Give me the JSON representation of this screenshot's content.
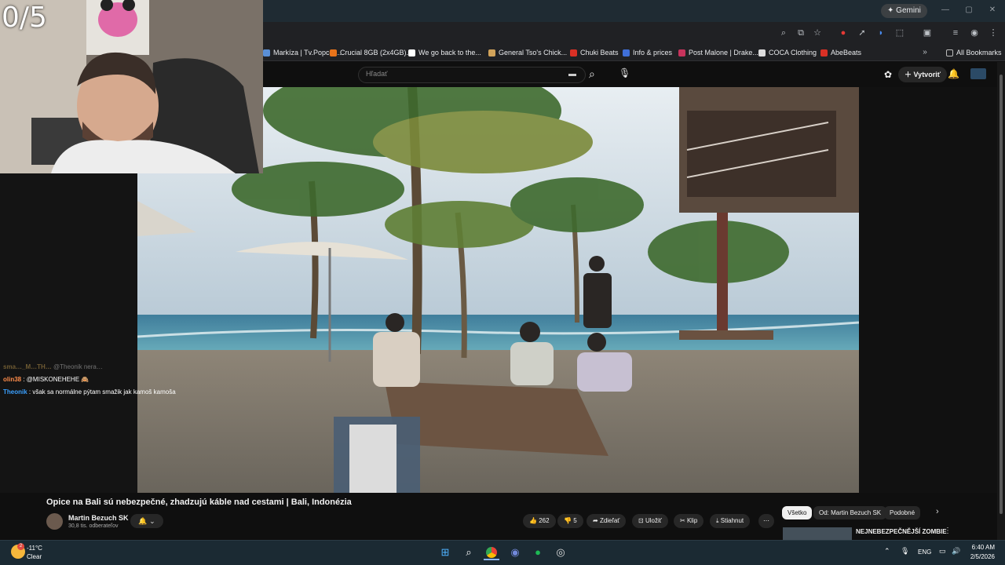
{
  "browser": {
    "gemini_label": "Gemini",
    "bookmarks": [
      {
        "label": "Markíza | Tv.Popcor...",
        "color": "#5a8fd6"
      },
      {
        "label": "Crucial 8GB (2x4GB)...",
        "color": "#e8731a"
      },
      {
        "label": "We go back to the...",
        "color": "#ffffff"
      },
      {
        "label": "General Tso's Chick...",
        "color": "#d1a35a"
      },
      {
        "label": "Chuki Beats",
        "color": "#d93025"
      },
      {
        "label": "Info & prices",
        "color": "#3f6fd8"
      },
      {
        "label": "Post Malone | Drake...",
        "color": "#c7335c"
      },
      {
        "label": "COCA Clothing",
        "color": "#dddddd"
      },
      {
        "label": "AbeBeats",
        "color": "#d93025"
      }
    ],
    "all_bookmarks": "All Bookmarks"
  },
  "youtube": {
    "search_placeholder": "Hľadať",
    "create_label": "Vytvoriť",
    "video_title": "Opice na Bali sú nebezpečné, zhadzujú káble nad cestami | Bali, Indonézia",
    "channel_name": "Martin Bezuch SK",
    "subscribers": "30,8 tis. odberateľov",
    "likes": "262",
    "dislikes": "5",
    "share": "Zdieľať",
    "save": "Uložiť",
    "clip": "Klip",
    "download": "Stiahnut",
    "chips": [
      "Všetko",
      "Od: Martin Bezuch SK",
      "Podobné"
    ],
    "rec_title": "NEJNEBEZPEČNĚJŠÍ ZOMBIE"
  },
  "stream": {
    "counter": "0/5",
    "chat": [
      {
        "user": "sma…_M…TH…",
        "message": "@Theonik nera…",
        "color": "#c8a050"
      },
      {
        "user": "olin38",
        "message": ": @MISKONEHEHE 🙈",
        "color": "#ff8c4a"
      },
      {
        "user": "Theonik",
        "message": ": však sa normálne pýtam smažik jak kamoš kamoša",
        "color": "#3aa0ff"
      }
    ]
  },
  "taskbar": {
    "weather_temp": "-11°C",
    "weather_desc": "Clear",
    "weather_badge": "2",
    "lang": "ENG",
    "time": "6:40 AM",
    "date": "2/5/2026"
  }
}
